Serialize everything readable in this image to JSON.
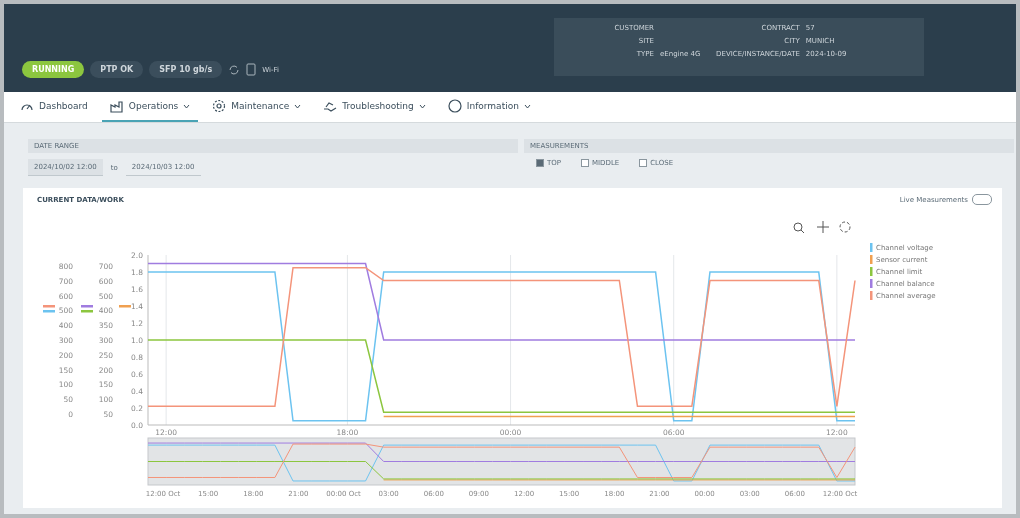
{
  "header": {
    "status_pills": [
      {
        "label": "RUNNING",
        "kind": "ok"
      },
      {
        "label": "PTP OK",
        "kind": "plain"
      },
      {
        "label": "SFP 10 gb/s",
        "kind": "plain"
      }
    ],
    "network_label": "Wi-Fi",
    "info": {
      "left": [
        {
          "label": "CUSTOMER"
        },
        {
          "label": "SITE"
        },
        {
          "label": "TYPE",
          "value": "eEngine 4G"
        }
      ],
      "right": [
        {
          "label": "CONTRACT",
          "value": "57"
        },
        {
          "label": "CITY",
          "value": "MUNICH"
        },
        {
          "label": "DEVICE/INSTANCE/DATE",
          "value": "2024-10-09"
        }
      ]
    }
  },
  "nav": {
    "tabs": [
      {
        "label": "Dashboard",
        "selected": false,
        "dropdown": false
      },
      {
        "label": "Operations",
        "selected": true,
        "dropdown": true
      },
      {
        "label": "Maintenance",
        "selected": false,
        "dropdown": true
      },
      {
        "label": "Troubleshooting",
        "selected": false,
        "dropdown": true
      },
      {
        "label": "Information",
        "selected": false,
        "dropdown": true
      }
    ]
  },
  "date_range": {
    "title": "DATE RANGE",
    "from": "2024/10/02 12:00",
    "separator": "to",
    "to": "2024/10/03 12:00"
  },
  "measurements": {
    "title": "MEASUREMENTS",
    "options": [
      {
        "label": "TOP",
        "checked": true
      },
      {
        "label": "MIDDLE",
        "checked": false
      },
      {
        "label": "CLOSE",
        "checked": false
      }
    ]
  },
  "card": {
    "title": "CURRENT DATA/WORK",
    "live_label": "Live Measurements",
    "live_on": false,
    "extra_axes": [
      {
        "markers": [
          {
            "color": "#f4947a"
          },
          {
            "color": "#6cc3f0"
          }
        ],
        "ticks": [
          "800",
          "700",
          "600",
          "500",
          "400",
          "300",
          "200",
          "150",
          "100",
          "50",
          "0"
        ]
      },
      {
        "markers": [
          {
            "color": "#a07ce0"
          },
          {
            "color": "#8cc63f"
          }
        ],
        "ticks": [
          "700",
          "600",
          "500",
          "400",
          "350",
          "300",
          "250",
          "200",
          "150",
          "100",
          "50"
        ]
      },
      {
        "markers": [
          {
            "color": "#f0a050"
          }
        ]
      }
    ],
    "chart_data": {
      "type": "line",
      "ylim": [
        0,
        2
      ],
      "yticks": [
        {
          "value": 0,
          "label": "0.0"
        },
        {
          "value": 0.2,
          "label": "0.2"
        },
        {
          "value": 0.4,
          "label": "0.4"
        },
        {
          "value": 0.6,
          "label": "0.6"
        },
        {
          "value": 0.8,
          "label": "0.8"
        },
        {
          "value": 1,
          "label": "1.0"
        },
        {
          "value": 1.2,
          "label": "1.2"
        },
        {
          "value": 1.4,
          "label": "1.4"
        },
        {
          "value": 1.6,
          "label": "1.6"
        },
        {
          "value": 1.8,
          "label": "1.8"
        },
        {
          "value": 2,
          "label": "2.0"
        }
      ],
      "categories": [
        null,
        "12:00",
        null,
        null,
        null,
        null,
        null,
        null,
        null,
        null,
        null,
        "18:00",
        null,
        null,
        null,
        null,
        null,
        null,
        null,
        null,
        "00:00",
        null,
        null,
        null,
        null,
        null,
        null,
        null,
        null,
        "06:00",
        null,
        null,
        null,
        null,
        null,
        null,
        null,
        null,
        "12:00",
        null
      ],
      "grid": true,
      "legend": true,
      "series": [
        {
          "name": "Channel voltage",
          "color": "#6cc3f0",
          "values": [
            1.8,
            1.8,
            1.8,
            1.8,
            1.8,
            1.8,
            1.8,
            1.8,
            0.05,
            0.05,
            0.05,
            0.05,
            0.05,
            1.8,
            1.8,
            1.8,
            1.8,
            1.8,
            1.8,
            1.8,
            1.8,
            1.8,
            1.8,
            1.8,
            1.8,
            1.8,
            1.8,
            1.8,
            1.8,
            0.05,
            0.05,
            1.8,
            1.8,
            1.8,
            1.8,
            1.8,
            1.8,
            1.8,
            0.05,
            0.05
          ]
        },
        {
          "name": "Sensor current",
          "color": "#f0a050",
          "values": [
            null,
            null,
            null,
            null,
            null,
            null,
            null,
            null,
            null,
            null,
            null,
            null,
            null,
            0.1,
            0.1,
            0.1,
            0.1,
            0.1,
            0.1,
            0.1,
            0.1,
            0.1,
            0.1,
            0.1,
            0.1,
            0.1,
            0.1,
            0.1,
            0.1,
            0.1,
            0.1,
            0.1,
            0.1,
            0.1,
            0.1,
            0.1,
            0.1,
            0.1,
            0.1,
            0.1
          ]
        },
        {
          "name": "Channel limit",
          "color": "#8cc63f",
          "values": [
            1,
            1,
            1,
            1,
            1,
            1,
            1,
            1,
            1,
            1,
            1,
            1,
            1,
            0.15,
            0.15,
            0.15,
            0.15,
            0.15,
            0.15,
            0.15,
            0.15,
            0.15,
            0.15,
            0.15,
            0.15,
            0.15,
            0.15,
            0.15,
            0.15,
            0.15,
            0.15,
            0.15,
            0.15,
            0.15,
            0.15,
            0.15,
            0.15,
            0.15,
            0.15,
            0.15
          ]
        },
        {
          "name": "Channel balance",
          "color": "#a07ce0",
          "values": [
            1.9,
            1.9,
            1.9,
            1.9,
            1.9,
            1.9,
            1.9,
            1.9,
            1.9,
            1.9,
            1.9,
            1.9,
            1.9,
            1,
            1,
            1,
            1,
            1,
            1,
            1,
            1,
            1,
            1,
            1,
            1,
            1,
            1,
            1,
            1,
            1,
            1,
            1,
            1,
            1,
            1,
            1,
            1,
            1,
            1,
            1
          ]
        },
        {
          "name": "Channel average",
          "color": "#f4947a",
          "values": [
            0.22,
            0.22,
            0.22,
            0.22,
            0.22,
            0.22,
            0.22,
            0.22,
            1.85,
            1.85,
            1.85,
            1.85,
            1.85,
            1.7,
            1.7,
            1.7,
            1.7,
            1.7,
            1.7,
            1.7,
            1.7,
            1.7,
            1.7,
            1.7,
            1.7,
            1.7,
            1.7,
            0.22,
            0.22,
            0.22,
            0.22,
            1.7,
            1.7,
            1.7,
            1.7,
            1.7,
            1.7,
            1.7,
            0.22,
            1.7
          ]
        }
      ]
    },
    "navigator_ticks": [
      "12:00 Oct",
      "15:00",
      "18:00",
      "21:00",
      "00:00 Oct",
      "03:00",
      "06:00",
      "09:00",
      "12:00",
      "15:00",
      "18:00",
      "21:00",
      "00:00",
      "03:00",
      "06:00",
      "12:00 Oct"
    ]
  }
}
